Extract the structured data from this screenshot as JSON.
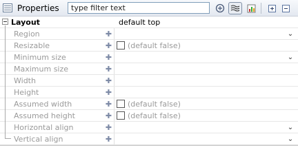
{
  "panel": {
    "title": "Properties",
    "filter_placeholder": "type filter text",
    "toolbar": [
      "sort-properties-icon",
      "show-advanced-icon",
      "show-preferred-icon",
      "expand-all-icon",
      "collapse-all-icon"
    ]
  },
  "group": {
    "name": "Layout",
    "value": "default top"
  },
  "properties": [
    {
      "name": "Region",
      "value": "",
      "kind": "dropdown"
    },
    {
      "name": "Resizable",
      "value": "(default false)",
      "kind": "checkbox"
    },
    {
      "name": "Minimum size",
      "value": "",
      "kind": "dropdown"
    },
    {
      "name": "Maximum size",
      "value": "",
      "kind": "empty"
    },
    {
      "name": "Width",
      "value": "",
      "kind": "empty"
    },
    {
      "name": "Height",
      "value": "",
      "kind": "empty"
    },
    {
      "name": "Assumed width",
      "value": "(default false)",
      "kind": "checkbox"
    },
    {
      "name": "Assumed height",
      "value": "(default false)",
      "kind": "checkbox"
    },
    {
      "name": "Horizontal align",
      "value": "",
      "kind": "dropdown"
    },
    {
      "name": "Vertical align",
      "value": "",
      "kind": "dropdown"
    }
  ]
}
